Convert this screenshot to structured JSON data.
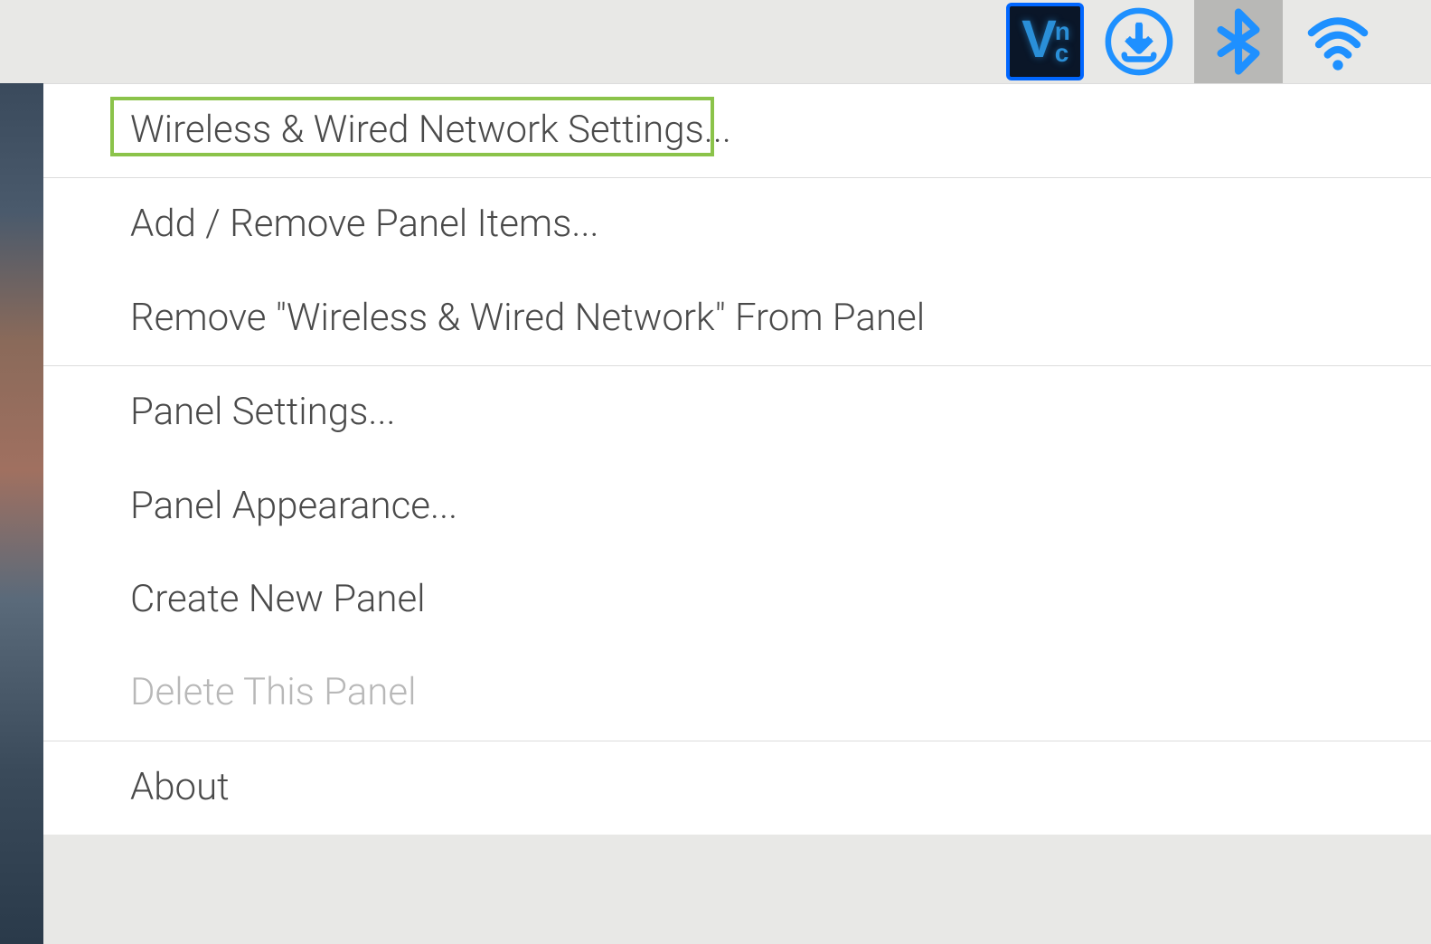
{
  "taskbar": {
    "icons": {
      "vnc": "vnc",
      "download": "download",
      "bluetooth": "bluetooth",
      "wifi": "wifi"
    }
  },
  "context_menu": {
    "items": [
      {
        "label": "Wireless & Wired Network Settings...",
        "highlighted": true,
        "disabled": false
      },
      {
        "label": "Add / Remove Panel Items...",
        "highlighted": false,
        "disabled": false
      },
      {
        "label": "Remove \"Wireless & Wired Network\" From Panel",
        "highlighted": false,
        "disabled": false
      },
      {
        "label": "Panel Settings...",
        "highlighted": false,
        "disabled": false
      },
      {
        "label": "Panel Appearance...",
        "highlighted": false,
        "disabled": false
      },
      {
        "label": "Create New Panel",
        "highlighted": false,
        "disabled": false
      },
      {
        "label": "Delete This Panel",
        "highlighted": false,
        "disabled": true
      },
      {
        "label": "About",
        "highlighted": false,
        "disabled": false
      }
    ],
    "separators_after": [
      0,
      2,
      6
    ]
  },
  "colors": {
    "accent_blue": "#1e90ff",
    "highlight_green": "#8bc34a",
    "taskbar_bg": "#e8e8e6",
    "menu_bg": "#ffffff",
    "text": "#4a4a4a",
    "text_disabled": "#b8b8b8"
  }
}
